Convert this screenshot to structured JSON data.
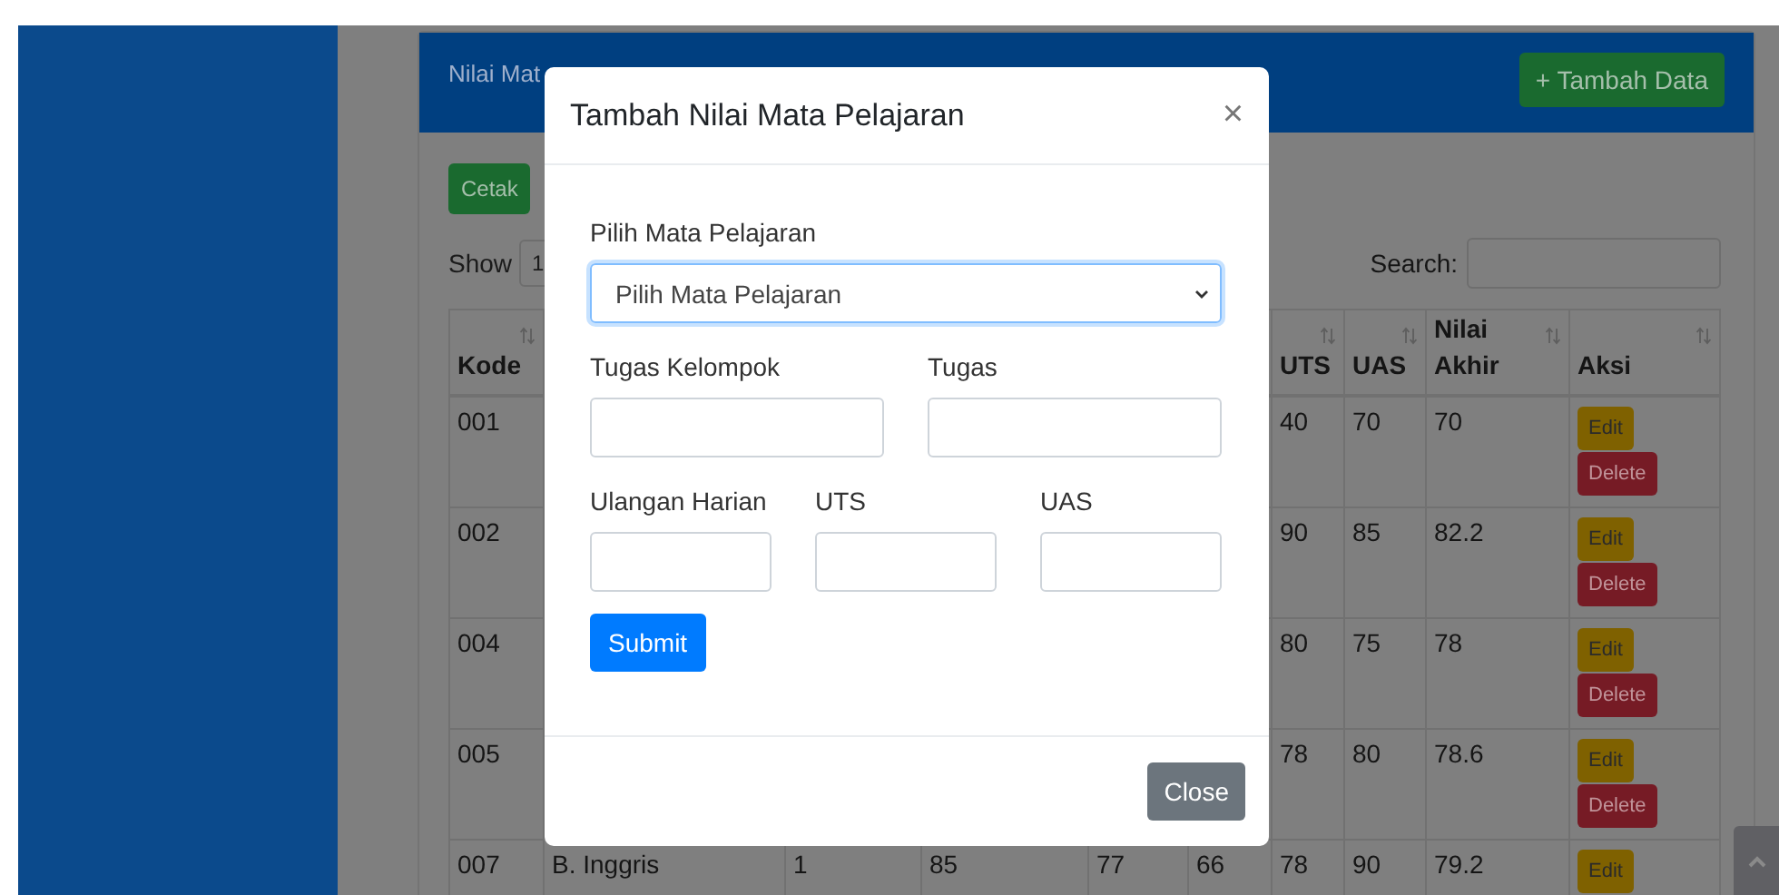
{
  "card": {
    "title": "Nilai Mat",
    "add_button": "+ Tambah Data",
    "print_button": "Cetak",
    "show_label": "Show",
    "page_size": "1",
    "search_label": "Search:"
  },
  "table": {
    "columns": [
      {
        "label": "Kode"
      },
      {},
      {},
      {},
      {},
      {},
      {
        "label": "UTS"
      },
      {
        "label": "UAS"
      },
      {
        "label": "Nilai Akhir"
      },
      {
        "label": "Aksi"
      }
    ],
    "rows": [
      {
        "cells": [
          "001",
          null,
          null,
          null,
          null,
          null,
          "40",
          "70",
          "70"
        ],
        "actions": [
          "Edit",
          "Delete"
        ]
      },
      {
        "cells": [
          "002",
          null,
          null,
          null,
          null,
          null,
          "90",
          "85",
          "82.2"
        ],
        "actions": [
          "Edit",
          "Delete"
        ]
      },
      {
        "cells": [
          "004",
          null,
          null,
          null,
          null,
          null,
          "80",
          "75",
          "78"
        ],
        "actions": [
          "Edit",
          "Delete"
        ]
      },
      {
        "cells": [
          "005",
          null,
          null,
          null,
          null,
          null,
          "78",
          "80",
          "78.6"
        ],
        "actions": [
          "Edit",
          "Delete"
        ]
      },
      {
        "cells": [
          "007",
          "B. Inggris",
          "1",
          "85",
          "77",
          "66",
          "78",
          "90",
          "79.2"
        ],
        "actions": [
          "Edit"
        ]
      }
    ]
  },
  "modal": {
    "title": "Tambah Nilai Mata Pelajaran",
    "close_symbol": "×",
    "rows": [
      [
        {
          "label": "Pilih Mata Pelajaran",
          "kind": "select",
          "value": "Pilih Mata Pelajaran",
          "focused": true
        }
      ],
      [
        {
          "label": "Tugas Kelompok",
          "kind": "input",
          "focused": false
        },
        {
          "label": "Tugas",
          "kind": "input",
          "focused": false
        }
      ],
      [
        {
          "label": "Ulangan Harian",
          "kind": "input",
          "focused": false
        },
        {
          "label": "UTS",
          "kind": "input",
          "focused": false
        },
        {
          "label": "UAS",
          "kind": "input",
          "focused": false
        }
      ]
    ],
    "submit_button": "Submit",
    "close_button": "Close"
  }
}
